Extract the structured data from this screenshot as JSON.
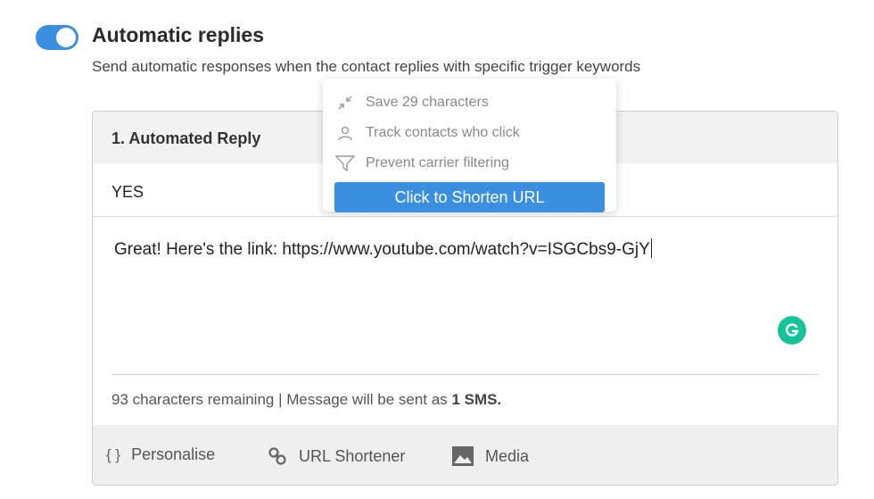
{
  "section": {
    "title": "Automatic replies",
    "subtitle": "Send automatic responses when the contact replies with specific trigger keywords",
    "toggle_on": true
  },
  "reply": {
    "header": "1. Automated Reply",
    "keyword": "YES",
    "message": "Great! Here's the link: https://www.youtube.com/watch?v=ISGCbs9-GjY",
    "counter_text": "93 characters remaining | Message will be sent as ",
    "counter_bold": "1 SMS."
  },
  "toolbar": {
    "personalise_label": "Personalise",
    "shortener_label": "URL Shortener",
    "media_label": "Media"
  },
  "popover": {
    "items": [
      {
        "icon": "compress-icon",
        "label": "Save 29 characters"
      },
      {
        "icon": "person-icon",
        "label": "Track contacts who click"
      },
      {
        "icon": "filter-icon",
        "label": "Prevent carrier filtering"
      }
    ],
    "button_label": "Click to Shorten URL"
  },
  "colors": {
    "accent": "#3b8fe0",
    "grammarly": "#15c39a"
  }
}
